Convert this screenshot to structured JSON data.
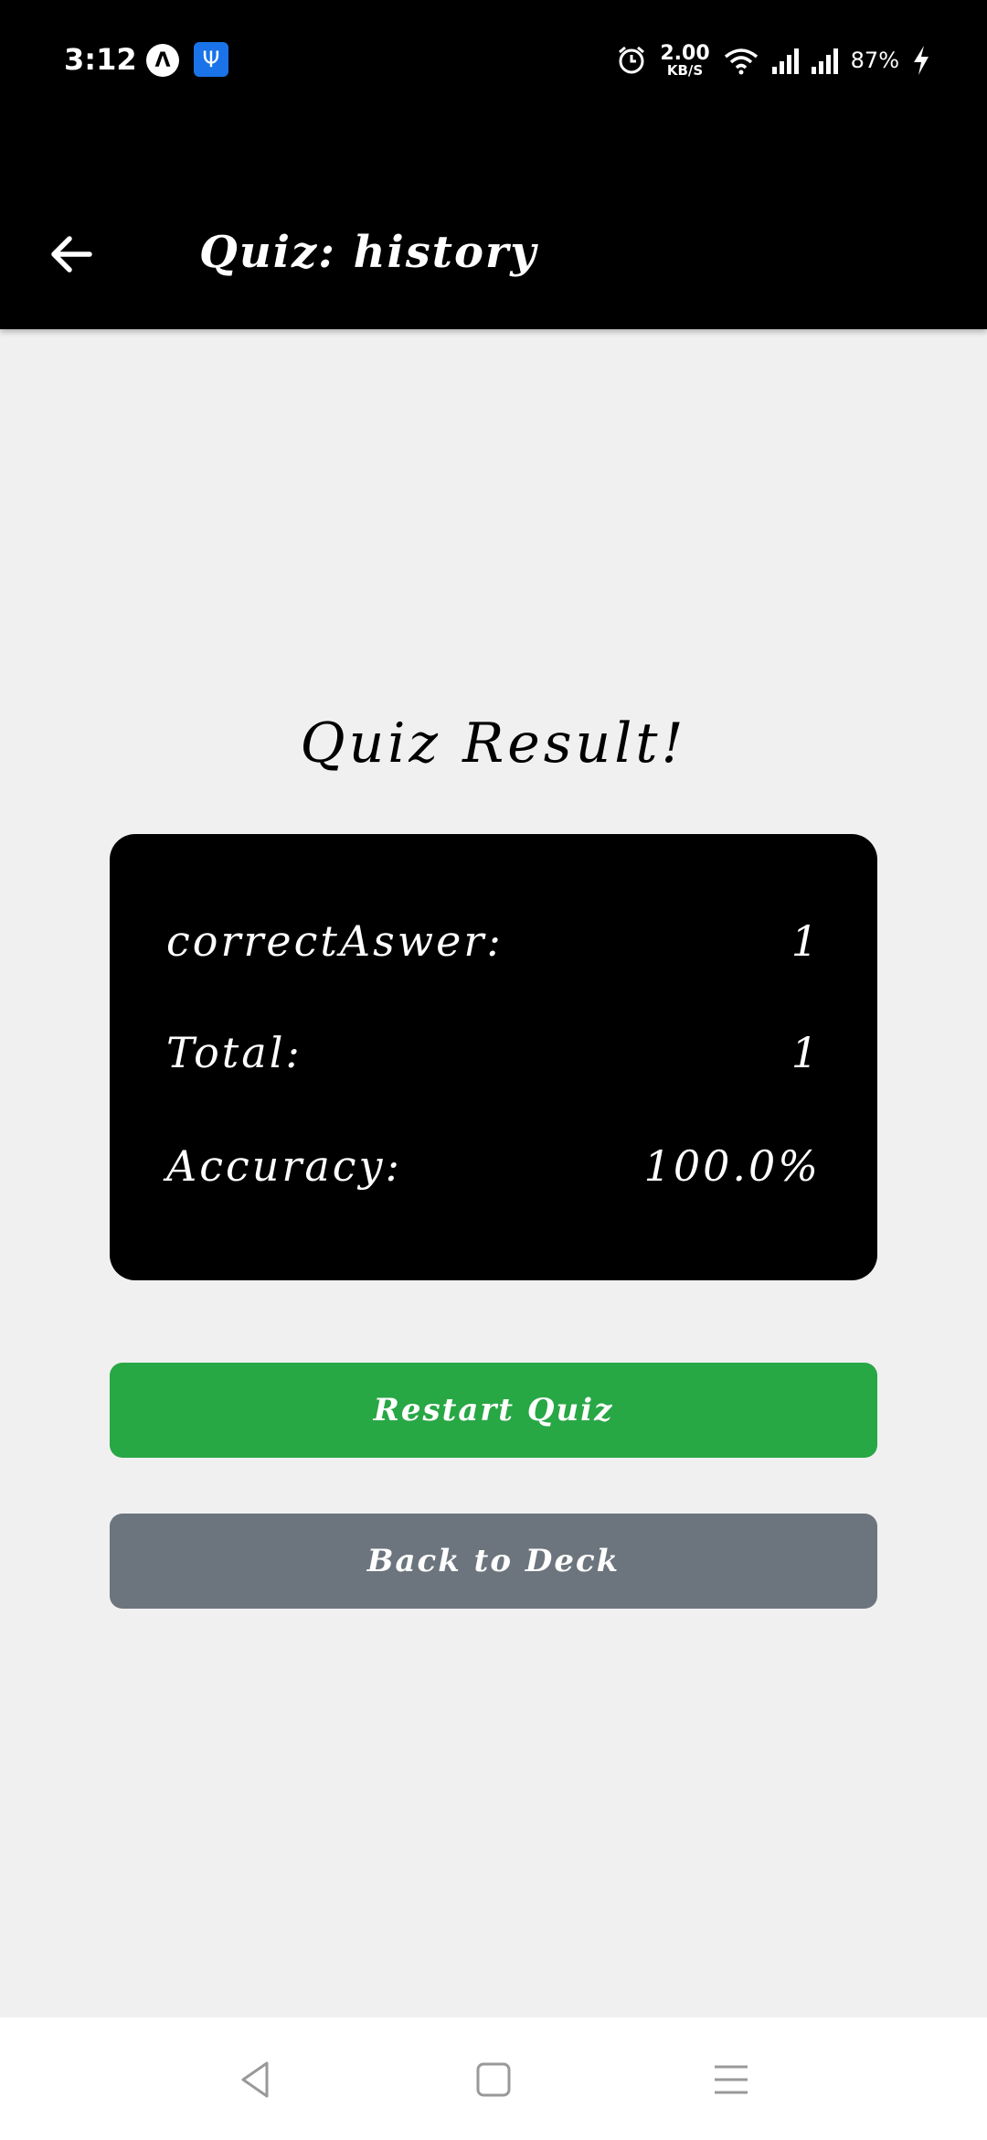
{
  "status_bar": {
    "time": "3:12",
    "net_speed_value": "2.00",
    "net_speed_unit": "KB/S",
    "battery": "87%"
  },
  "app_bar": {
    "title": "Quiz: history"
  },
  "result": {
    "title": "Quiz Result!",
    "rows": [
      {
        "label": "correctAswer:",
        "value": "1"
      },
      {
        "label": "Total:",
        "value": "1"
      },
      {
        "label": "Accuracy:",
        "value": "100.0%"
      }
    ]
  },
  "buttons": {
    "restart": "Restart Quiz",
    "back_to_deck": "Back to Deck"
  },
  "colors": {
    "app_bar": "#000000",
    "background": "#f0f0f0",
    "restart_button": "#28a745",
    "back_button": "#6c757d"
  },
  "icons": [
    "alarm-icon",
    "wifi-icon",
    "signal-icon",
    "charging-icon",
    "back-arrow-icon",
    "nav-back-icon",
    "nav-home-icon",
    "nav-recents-icon"
  ]
}
